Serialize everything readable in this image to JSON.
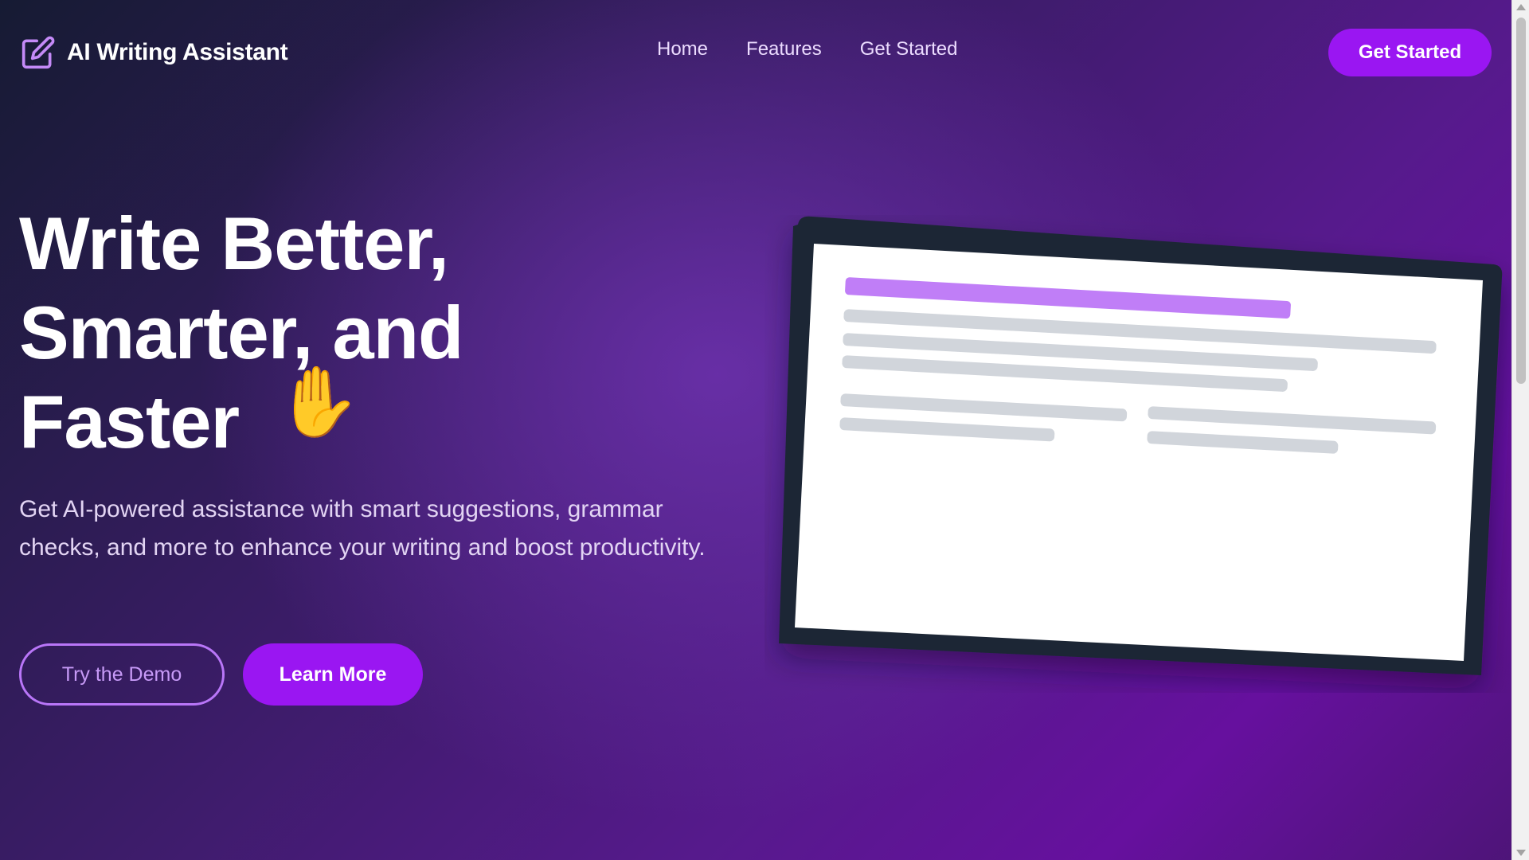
{
  "brand": {
    "title": "AI Writing Assistant",
    "icon": "edit-square-icon"
  },
  "nav": {
    "items": [
      {
        "label": "Home"
      },
      {
        "label": "Features"
      },
      {
        "label": "Get Started"
      }
    ],
    "cta_label": "Get Started"
  },
  "hero": {
    "heading_lines": [
      "Write Better,",
      "Smarter, and",
      "Faster"
    ],
    "emoji": "✋",
    "subtitle": "Get AI-powered assistance with smart suggestions, grammar checks, and more to enhance your writing and boost productivity.",
    "primary_button": "Try the Demo",
    "secondary_button": "Learn More"
  },
  "illustration": {
    "name": "laptop-document-illustration",
    "highlight_color": "#c07ef7",
    "placeholder_color": "#d1d5db",
    "frame_color": "#1e2836"
  },
  "colors": {
    "accent": "#9a16f2",
    "accent_light": "#b976f8",
    "background_start": "#161b33",
    "background_end": "#66109e"
  }
}
